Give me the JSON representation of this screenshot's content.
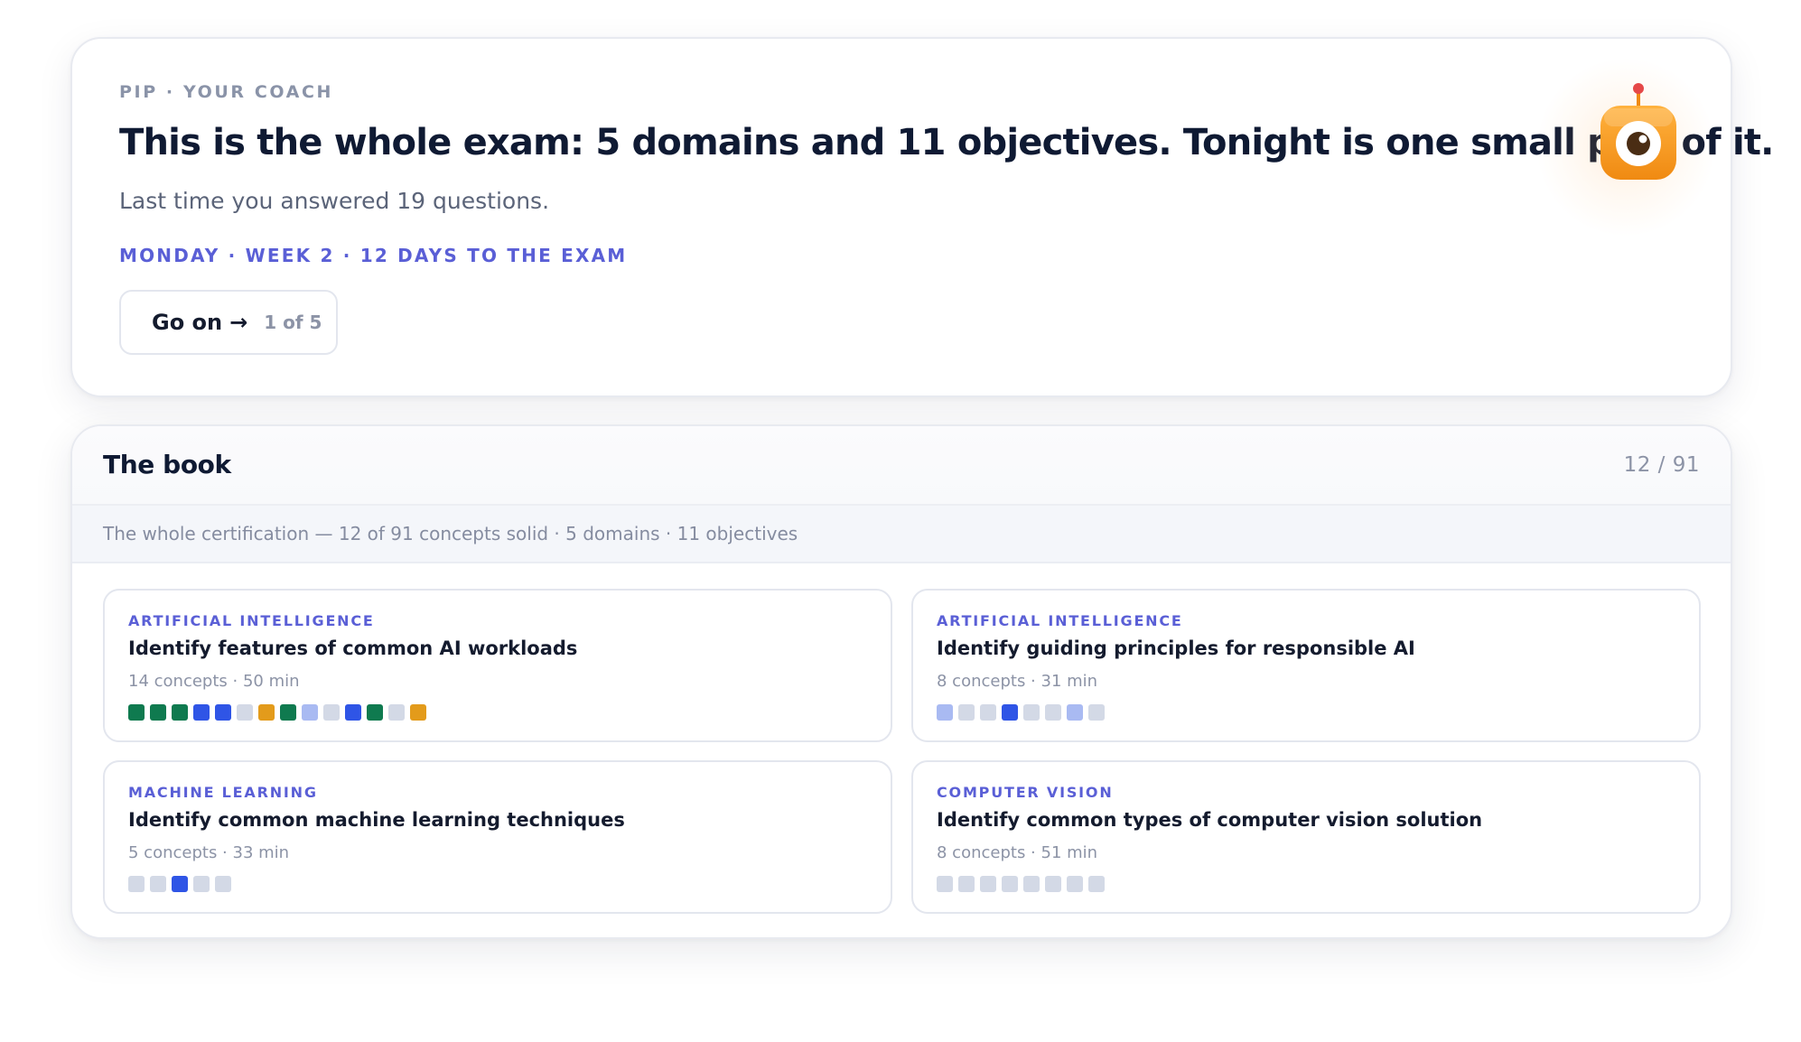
{
  "coach": {
    "eyebrow": "PIP · YOUR COACH",
    "headline": {
      "part1": "This is the whole exam: ",
      "domains": "5 domains",
      "part2": " and ",
      "objectives": "11 objectives",
      "part3": ". Tonight is one small part of it."
    },
    "subline": "Last time you answered 19 questions.",
    "dateline": "MONDAY · WEEK 2 · 12 DAYS TO THE EXAM",
    "button": {
      "label": "Go on",
      "arrow": "→",
      "count": "1 of 5"
    },
    "mascot_icon": "robot-eye-icon"
  },
  "colors": {
    "accent": "#5a5fd6",
    "solid": "#0f7a4f",
    "learning": "#2f55e6",
    "shaky": "#e39b1b",
    "started": "#a9baf2",
    "new": "#d3d9e6"
  },
  "book": {
    "title": "The book",
    "count": "12 / 91",
    "summary": "The whole certification — 12 of 91 concepts solid · 5 domains · 11 objectives",
    "objectives": [
      {
        "domain": "ARTIFICIAL INTELLIGENCE",
        "title": "Identify features of common AI workloads",
        "meta": "14 concepts · 50 min",
        "concepts": [
          "solid",
          "solid",
          "solid",
          "learning",
          "learning",
          "new",
          "shaky",
          "solid",
          "started",
          "new",
          "learning",
          "solid",
          "new",
          "shaky"
        ]
      },
      {
        "domain": "ARTIFICIAL INTELLIGENCE",
        "title": "Identify guiding principles for responsible AI",
        "meta": "8 concepts · 31 min",
        "concepts": [
          "started",
          "new",
          "new",
          "learning",
          "new",
          "new",
          "started",
          "new"
        ]
      },
      {
        "domain": "MACHINE LEARNING",
        "title": "Identify common machine learning techniques",
        "meta": "5 concepts · 33 min",
        "concepts": [
          "new",
          "new",
          "learning",
          "new",
          "new"
        ]
      },
      {
        "domain": "COMPUTER VISION",
        "title": "Identify common types of computer vision solution",
        "meta": "8 concepts · 51 min",
        "concepts": [
          "new",
          "new",
          "new",
          "new",
          "new",
          "new",
          "new",
          "new"
        ]
      }
    ]
  }
}
